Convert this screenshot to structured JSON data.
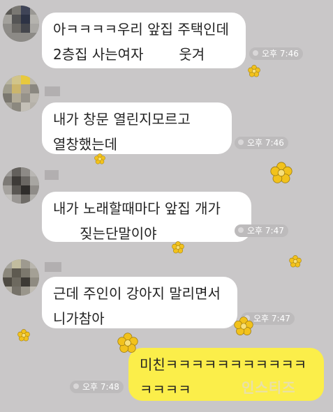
{
  "messages": [
    {
      "lines": [
        "아ㅋㅋㅋㅋ우리 앞집 주택인데",
        "2층집 사는여자        웃겨"
      ],
      "time": "오후 7:46"
    },
    {
      "lines": [
        "내가 창문 열린지모르고",
        "열창했는데"
      ],
      "time": "오후 7:46"
    },
    {
      "lines": [
        "내가 노래할때마다 앞집 개가",
        "      짖는단말이야"
      ],
      "time": "오후 7:47"
    },
    {
      "lines": [
        "근데 주인이 강아지 말리면서",
        "니가참아"
      ],
      "time": "오후 7:47"
    },
    {
      "lines": [
        "미친ㅋㅋㅋㅋㅋㅋㅋㅋㅋㅋㅋ",
        "ㅋㅋㅋㅋ"
      ],
      "time": "오후 7:48"
    }
  ],
  "watermark": "인스티즈",
  "colors": {
    "background": "#c9c7c8",
    "incoming_bubble": "#ffffff",
    "outgoing_bubble": "#fbee4a",
    "flower": "#f2c21c"
  }
}
